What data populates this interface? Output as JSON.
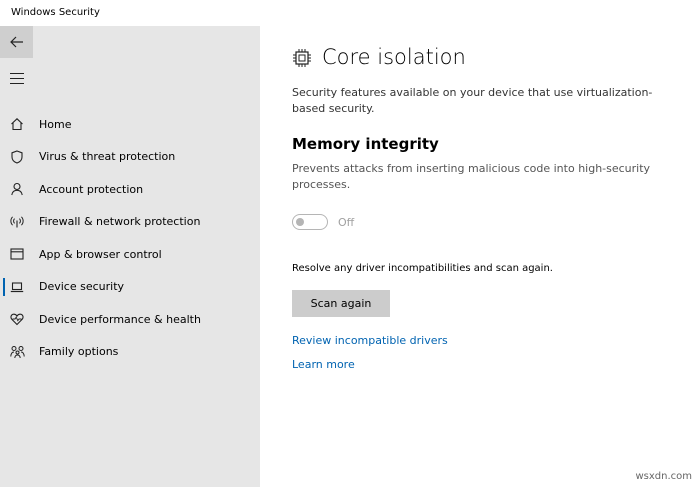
{
  "window": {
    "title": "Windows Security"
  },
  "sidebar": {
    "items": [
      {
        "label": "Home",
        "icon": "home-icon",
        "active": false
      },
      {
        "label": "Virus & threat protection",
        "icon": "shield-icon",
        "active": false
      },
      {
        "label": "Account protection",
        "icon": "person-icon",
        "active": false
      },
      {
        "label": "Firewall & network protection",
        "icon": "wifi-antenna-icon",
        "active": false
      },
      {
        "label": "App & browser control",
        "icon": "browser-window-icon",
        "active": false
      },
      {
        "label": "Device security",
        "icon": "laptop-icon",
        "active": true
      },
      {
        "label": "Device performance & health",
        "icon": "heart-pulse-icon",
        "active": false
      },
      {
        "label": "Family options",
        "icon": "family-icon",
        "active": false
      }
    ]
  },
  "main": {
    "title": "Core isolation",
    "description": "Security features available on your device that use virtualization-based security.",
    "memory_integrity": {
      "title": "Memory integrity",
      "description": "Prevents attacks from inserting malicious code into high-security processes.",
      "toggle_state": "Off"
    },
    "resolve_text": "Resolve any driver incompatibilities and scan again.",
    "scan_button": "Scan again",
    "links": {
      "review": "Review incompatible drivers",
      "learn": "Learn more"
    }
  },
  "watermark": "wsxdn.com",
  "colors": {
    "sidebar_bg": "#e6e6e6",
    "accent": "#0063b1",
    "button_bg": "#cccccc"
  }
}
